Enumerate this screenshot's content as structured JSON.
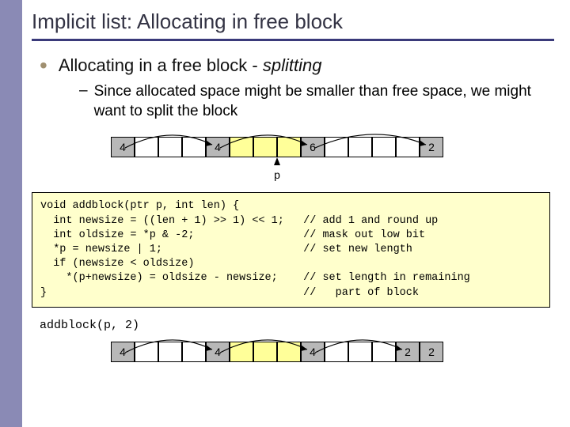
{
  "title": "Implicit list: Allocating in free block",
  "bullet": {
    "main_pre": "Allocating in a free block - ",
    "main_em": "splitting",
    "sub": "Since allocated space might be smaller than free space, we might want to split the block"
  },
  "diagram_before": {
    "headers": [
      "4",
      "4",
      "6",
      "2"
    ],
    "pointer_label": "p"
  },
  "code": {
    "l1": "void addblock(ptr p, int len) {",
    "l2": "  int newsize = ((len + 1) >> 1) << 1;   // add 1 and round up",
    "l3": "  int oldsize = *p & -2;                 // mask out low bit",
    "l4": "  *p = newsize | 1;                      // set new length",
    "l5": "  if (newsize < oldsize)",
    "l6": "    *(p+newsize) = oldsize - newsize;    // set length in remaining",
    "l7": "}                                        //   part of block"
  },
  "call": "addblock(p, 2)",
  "diagram_after": {
    "headers": [
      "4",
      "4",
      "4",
      "2",
      "2"
    ]
  }
}
